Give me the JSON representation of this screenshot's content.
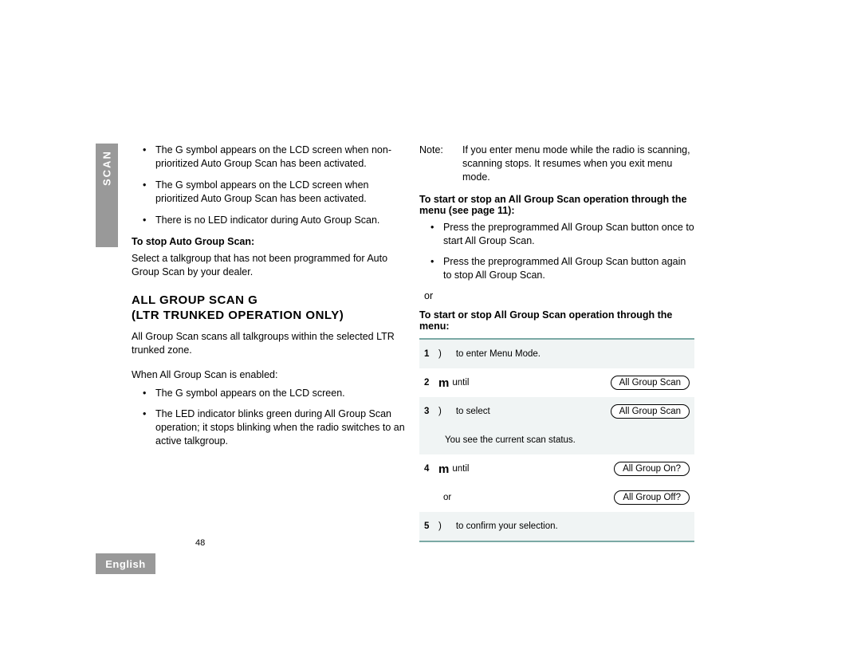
{
  "sideLabel": "SCAN",
  "langLabel": "English",
  "pageNumber": "48",
  "col1": {
    "bullets1": [
      "The G      symbol appears on the LCD screen when non-prioritized Auto Group Scan has been activated.",
      "The G      symbol appears on the LCD screen when prioritized Auto Group Scan has been activated.",
      "There is no LED indicator during Auto Group Scan."
    ],
    "stopHead": "To stop Auto Group Scan:",
    "stopBody": "Select a talkgroup that has not been programmed for Auto Group Scan by your dealer.",
    "sectTitle": "ALL GROUP SCAN G",
    "sectSub": "(LTR TRUNKED OPERATION ONLY)",
    "allGroupIntro": "All Group Scan scans all talkgroups within the selected LTR trunked zone.",
    "enabledHead": "When All Group Scan is enabled:",
    "bullets2": [
      "The G      symbol appears on the LCD screen.",
      "The LED indicator blinks green during All Group Scan operation; it stops blinking when the radio switches to an active talkgroup."
    ]
  },
  "col2": {
    "note": {
      "label": "Note:",
      "text": "If you enter menu mode while the radio is scanning, scanning stops. It resumes when you exit menu mode."
    },
    "startStopHead": "To start or stop an All Group Scan operation through the menu (see page 11):",
    "bullets": [
      "Press the preprogrammed All Group Scan button once to start All Group Scan.",
      "Press the preprogrammed All Group Scan button again to stop All Group Scan."
    ],
    "or": "or",
    "startStopMenuHead": "To start or stop All Group Scan operation through the menu:",
    "steps": {
      "s1": {
        "num": "1",
        "sym": ")",
        "text": "to enter Menu Mode."
      },
      "s2": {
        "num": "2",
        "sym": "m",
        "text": "until",
        "pill": "All Group Scan"
      },
      "s3": {
        "num": "3",
        "sym": ")",
        "text": "to select",
        "pill": "All Group Scan"
      },
      "status": "You see the current scan status.",
      "s4": {
        "num": "4",
        "sym": "m",
        "text": "until",
        "pill": "All Group On?"
      },
      "s4b": {
        "text": "or",
        "pill": "All Group Off?"
      },
      "s5": {
        "num": "5",
        "sym": ")",
        "text": "to confirm your selection."
      }
    }
  }
}
